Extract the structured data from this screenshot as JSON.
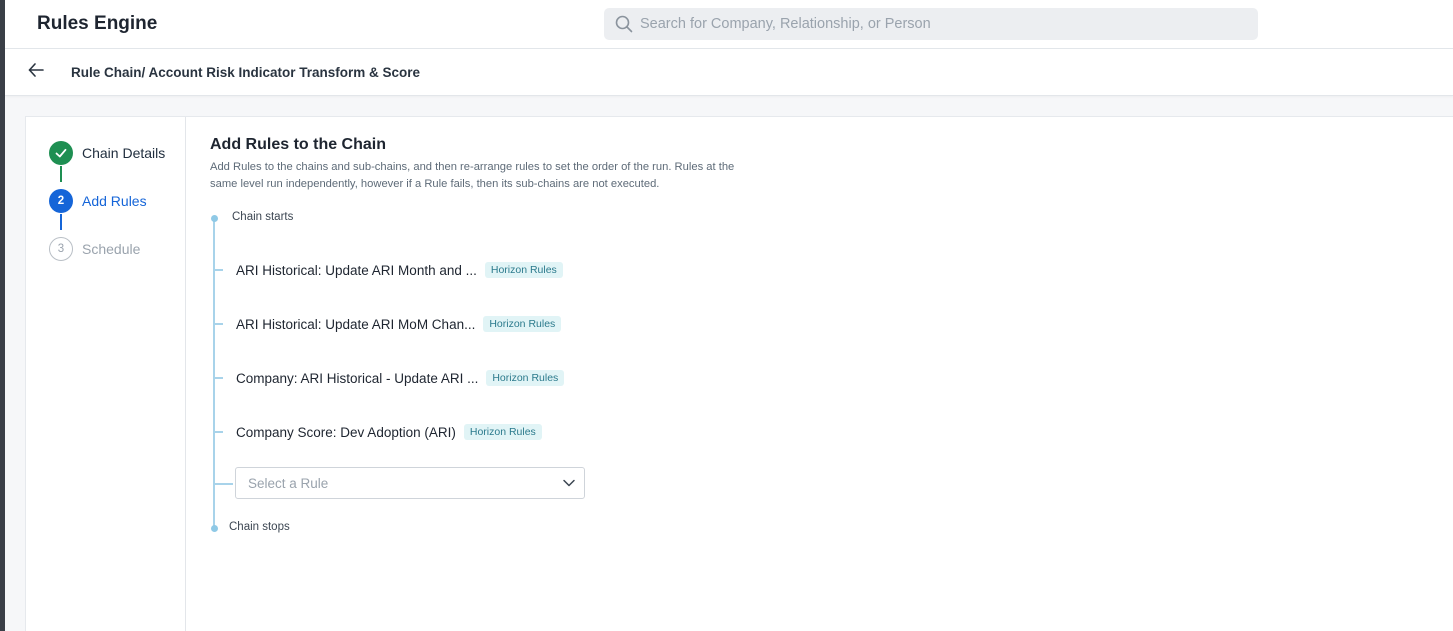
{
  "app": {
    "title": "Rules Engine"
  },
  "search": {
    "placeholder": "Search for Company, Relationship, or Person"
  },
  "breadcrumb": {
    "text": "Rule Chain/ Account Risk Indicator Transform & Score"
  },
  "stepper": {
    "steps": [
      {
        "number": "1",
        "label": "Chain Details",
        "state": "complete"
      },
      {
        "number": "2",
        "label": "Add Rules",
        "state": "active"
      },
      {
        "number": "3",
        "label": "Schedule",
        "state": "pending"
      }
    ]
  },
  "main": {
    "title": "Add Rules to the Chain",
    "description": "Add Rules to the chains and sub-chains, and then re-arrange rules to set the order of the run. Rules at the same level run independently, however if a Rule fails, then its sub-chains are not executed."
  },
  "chain": {
    "start_label": "Chain starts",
    "stop_label": "Chain stops",
    "rules": [
      {
        "name": "ARI Historical: Update ARI Month and ...",
        "badge": "Horizon Rules"
      },
      {
        "name": "ARI Historical: Update ARI MoM Chan...",
        "badge": "Horizon Rules"
      },
      {
        "name": "Company: ARI Historical - Update ARI ...",
        "badge": "Horizon Rules"
      },
      {
        "name": "Company Score: Dev Adoption (ARI)",
        "badge": "Horizon Rules"
      }
    ],
    "select_placeholder": "Select a Rule"
  },
  "colors": {
    "complete": "#1e8f52",
    "active": "#1565d8",
    "timeline": "#a8d3ea",
    "badge_bg": "#e1f4f6"
  }
}
